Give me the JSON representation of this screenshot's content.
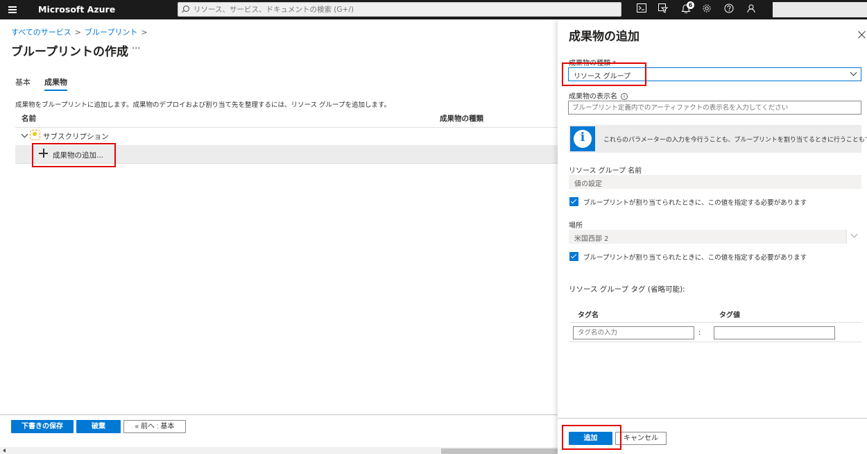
{
  "topbar": {
    "brand": "Microsoft Azure",
    "search_placeholder": "リソース、サービス、ドキュメントの検索 (G+/)",
    "notification_count": "6"
  },
  "breadcrumb": [
    "すべてのサービス",
    "ブループリント"
  ],
  "page_title": "ブループリントの作成",
  "more_label": "···",
  "tabs": [
    {
      "label": "基本"
    },
    {
      "label": "成果物"
    }
  ],
  "description": "成果物をブループリントに追加します。成果物のデプロイおよび割り当て先を整理するには、リソース グループを追加します。",
  "table": {
    "columns": [
      "名前",
      "成果物の種類"
    ],
    "subscription_label": "サブスクリプション",
    "add_artifact_label": "成果物の追加..."
  },
  "footer": {
    "save_draft": "下書きの保存",
    "discard": "破棄",
    "previous": "« 前へ : 基本"
  },
  "panel": {
    "title": "成果物の追加",
    "artifact_type_label": "成果物の種類",
    "required_mark": "*",
    "artifact_type_value": "リソース グループ",
    "display_name_label": "成果物の表示名",
    "display_name_placeholder": "ブループリント定義内でのアーティファクトの表示名を入力してください",
    "info_text": "これらのパラメーターの入力を今行うことも、ブループリントを割り当てるときに行うこともできます。",
    "rg_name_label": "リソース グループ 名前",
    "rg_name_value": "値の設定",
    "checkbox_label": "ブループリントが割り当てられたときに、この値を指定する必要があります",
    "location_label": "場所",
    "location_value": "米国西部 2",
    "tags_label": "リソース グループ タグ (省略可能):",
    "tag_name_header": "タグ名",
    "tag_value_header": "タグ値",
    "tag_name_placeholder": "タグ名の入力",
    "tag_separator": ":",
    "add_button": "追加",
    "cancel_button": "キャンセル"
  },
  "colors": {
    "accent": "#0078d4",
    "highlight": "#e00000",
    "topbar": "#1b1b1b"
  }
}
